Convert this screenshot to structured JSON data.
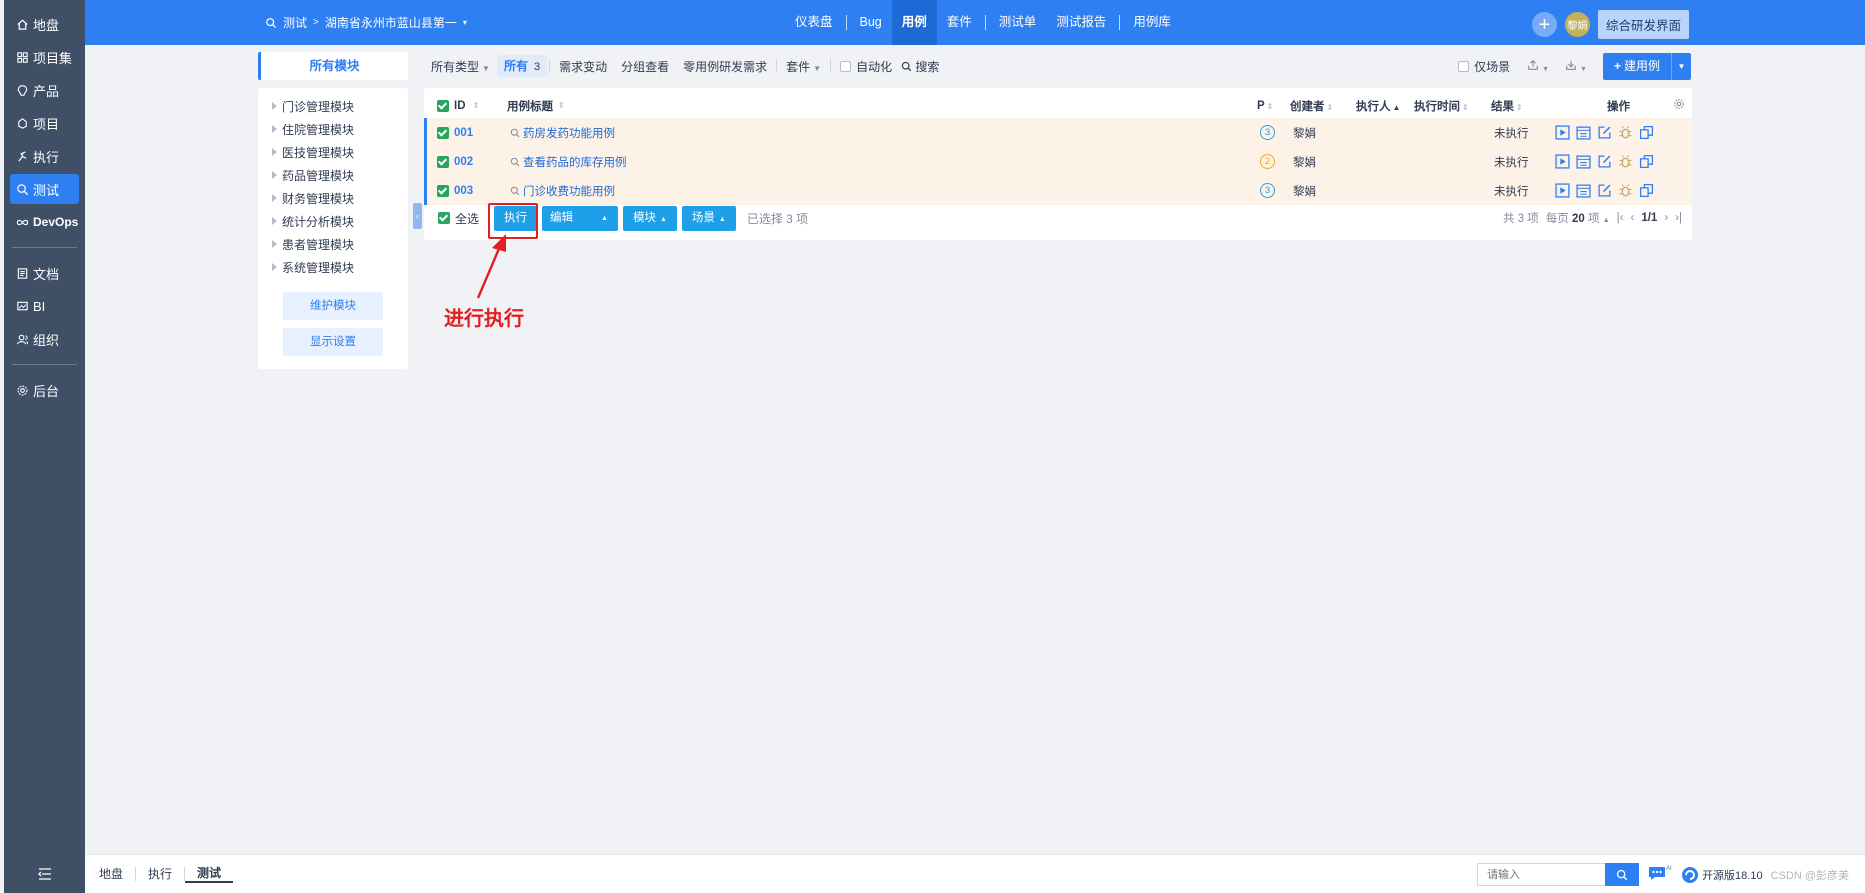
{
  "sidebar": {
    "items": [
      {
        "label": "地盘",
        "icon": "home-icon"
      },
      {
        "label": "项目集",
        "icon": "grid-icon"
      },
      {
        "label": "产品",
        "icon": "lightbulb-icon"
      },
      {
        "label": "项目",
        "icon": "cube-icon"
      },
      {
        "label": "执行",
        "icon": "run-icon"
      },
      {
        "label": "测试",
        "icon": "search-icon",
        "active": true
      },
      {
        "label": "DevOps",
        "icon": "infinity-icon"
      },
      {
        "label": "文档",
        "icon": "doc-icon"
      },
      {
        "label": "BI",
        "icon": "bi-icon"
      },
      {
        "label": "组织",
        "icon": "people-icon"
      },
      {
        "label": "后台",
        "icon": "gear-icon"
      }
    ]
  },
  "header": {
    "crumb_app": "测试",
    "crumb_product": "湖南省永州市蓝山县第一人",
    "nav": [
      "仪表盘",
      "Bug",
      "用例",
      "套件",
      "测试单",
      "测试报告",
      "用例库"
    ],
    "active_nav": "用例",
    "avatar_text": "黎娟",
    "rd_button": "综合研发界面"
  },
  "modules": {
    "all_tab": "所有模块",
    "items": [
      "门诊管理模块",
      "住院管理模块",
      "医技管理模块",
      "药品管理模块",
      "财务管理模块",
      "统计分析模块",
      "患者管理模块",
      "系统管理模块"
    ],
    "maintain_button": "维护模块",
    "display_button": "显示设置"
  },
  "toolbar": {
    "type_filter": "所有类型",
    "all_label": "所有",
    "all_count": "3",
    "req_change": "需求变动",
    "group_view": "分组查看",
    "zero_case": "零用例研发需求",
    "suite": "套件",
    "auto_label": "自动化",
    "search_label": "搜索",
    "scene_only": "仅场景",
    "new_case": "建用例"
  },
  "table": {
    "headers": {
      "id": "ID",
      "title": "用例标题",
      "p": "P",
      "creator": "创建者",
      "executor": "执行人",
      "exec_time": "执行时间",
      "result": "结果",
      "ops": "操作"
    },
    "rows": [
      {
        "id": "001",
        "title": "药房发药功能用例",
        "p": "3",
        "creator": "黎娟",
        "executor": "",
        "exec_time": "",
        "result": "未执行"
      },
      {
        "id": "002",
        "title": "查看药品的库存用例",
        "p": "2",
        "creator": "黎娟",
        "executor": "",
        "exec_time": "",
        "result": "未执行"
      },
      {
        "id": "003",
        "title": "门诊收费功能用例",
        "p": "3",
        "creator": "黎娟",
        "executor": "",
        "exec_time": "",
        "result": "未执行"
      }
    ],
    "select_all": "全选",
    "actions": {
      "execute": "执行",
      "edit": "编辑",
      "module": "模块",
      "scene": "场景"
    },
    "selected_text": "已选择 3 项",
    "total_text": "共 3 项",
    "per_page_prefix": "每页",
    "per_page": "20",
    "per_page_suffix": "项",
    "page": "1/1"
  },
  "annotation": {
    "text": "进行执行",
    "color": "#e02020"
  },
  "footer": {
    "breadcrumbs": [
      "地盘",
      "执行",
      "测试"
    ],
    "search_placeholder": "请输入",
    "version": "开源版18.10",
    "watermark": "CSDN @彭彦美"
  },
  "colors": {
    "primary": "#2e7ff2",
    "sidebar": "#3e4f66",
    "row_highlight": "#fdf2e8",
    "action_button": "#1ea0e8"
  }
}
